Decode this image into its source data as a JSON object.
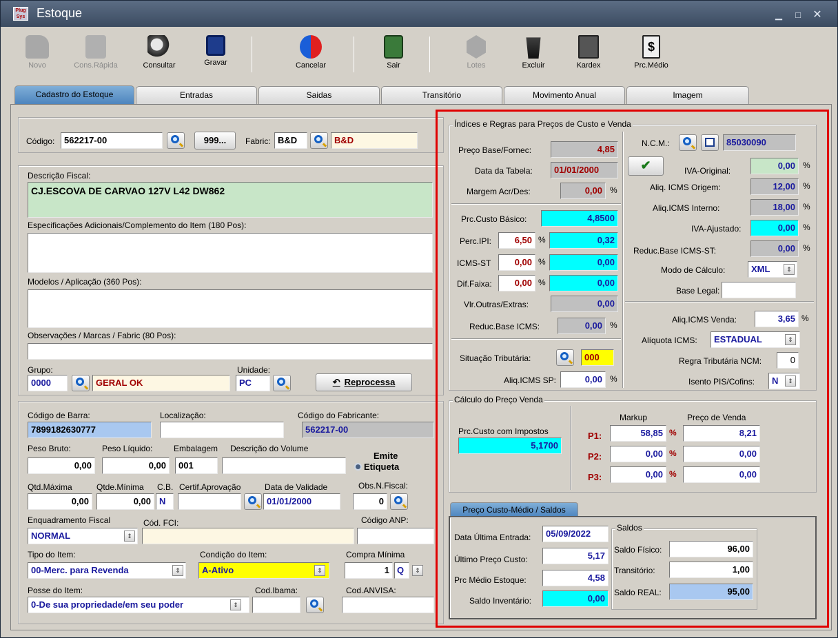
{
  "window": {
    "title": "Estoque",
    "logo": "Plug Sys"
  },
  "toolbar": [
    {
      "label": "Novo",
      "icon": "hand-icon",
      "enabled": false
    },
    {
      "label": "Cons.Rápida",
      "icon": "computer-icon",
      "enabled": false
    },
    {
      "label": "Consultar",
      "icon": "magnifier-icon",
      "enabled": true
    },
    {
      "label": "Gravar",
      "icon": "floppy-icon",
      "enabled": true
    },
    {
      "label": "Cancelar",
      "icon": "refresh-icon",
      "enabled": true
    },
    {
      "label": "Sair",
      "icon": "exit-door-icon",
      "enabled": true
    },
    {
      "label": "Lotes",
      "icon": "hexagon-icon",
      "enabled": false
    },
    {
      "label": "Excluir",
      "icon": "trash-icon",
      "enabled": true
    },
    {
      "label": "Kardex",
      "icon": "folder-icon",
      "enabled": true
    },
    {
      "label": "Prc.Médio",
      "icon": "dollar-doc-icon",
      "enabled": true
    }
  ],
  "tabs": [
    "Cadastro do Estoque",
    "Entradas",
    "Saidas",
    "Transitório",
    "Movimento Anual",
    "Imagem"
  ],
  "left": {
    "codigo_label": "Código:",
    "codigo": "562217-00",
    "btn999": "999...",
    "fabric_label": "Fabric:",
    "fabric_code": "B&D",
    "fabric_name": "B&D",
    "descricao_label": "Descrição Fiscal:",
    "descricao": "CJ.ESCOVA DE CARVAO 127V L42 DW862",
    "especificacoes_label": "Especificações Adicionais/Complemento do Item (180 Pos):",
    "modelos_label": "Modelos / Aplicação (360 Pos):",
    "observacoes_label": "Observações / Marcas / Fabric (80 Pos):",
    "grupo_label": "Grupo:",
    "grupo_code": "0000",
    "grupo_name": "GERAL OK",
    "unidade_label": "Unidade:",
    "unidade": "PC",
    "reprocessa": "Reprocessa",
    "codbarra_label": "Código de Barra:",
    "codbarra": "7899182630777",
    "localizacao_label": "Localização:",
    "codfab_label": "Código do Fabricante:",
    "codfab": "562217-00",
    "pesobruto_label": "Peso Bruto:",
    "pesobruto": "0,00",
    "pesoliq_label": "Peso Líquido:",
    "pesoliq": "0,00",
    "embalagem_label": "Embalagem",
    "embalagem": "001",
    "descvol_label": "Descrição do Volume",
    "emite_label": "Emite",
    "etiqueta_label": "Etiqueta",
    "qtdmax_label": "Qtd.Máxima",
    "qtdmax": "0,00",
    "qtdmin_label": "Qtde.Mínima",
    "qtdmin": "0,00",
    "cb_label": "C.B.",
    "cb": "N",
    "certif_label": "Certif.Aprovação",
    "validade_label": "Data de Validade",
    "validade": "01/01/2000",
    "obsnf_label": "Obs.N.Fiscal:",
    "obsnf": "0",
    "enquad_label": "Enquadramento Fiscal",
    "enquad": "NORMAL",
    "codfci_label": "Cód. FCI:",
    "anp_label": "Código ANP:",
    "tipo_label": "Tipo do Item:",
    "tipo": "00-Merc. para Revenda",
    "condicao_label": "Condição do Item:",
    "condicao": "A-Ativo",
    "compramin_label": "Compra Mínima",
    "compramin": "1",
    "compramin_unit": "Q",
    "posse_label": "Posse do Item:",
    "posse": "0-De sua propriedade/em seu poder",
    "ibama_label": "Cod.Ibama:",
    "anvisa_label": "Cod.ANVISA:"
  },
  "indices": {
    "legend": "Índices e Regras para Preços de Custo e Venda",
    "precobase_label": "Preço Base/Fornec:",
    "precobase": "4,85",
    "datatabela_label": "Data da Tabela:",
    "datatabela": "01/01/2000",
    "margem_label": "Margem Acr/Des:",
    "margem": "0,00",
    "custobasico_label": "Prc.Custo Básico:",
    "custobasico": "4,8500",
    "percipi_label": "Perc.IPI:",
    "percipi": "6,50",
    "percipi_val": "0,32",
    "icmsst_label": "ICMS-ST",
    "icmsst": "0,00",
    "icmsst_val": "0,00",
    "diffaixa_label": "Dif.Faixa:",
    "diffaixa": "0,00",
    "diffaixa_val": "0,00",
    "outras_label": "Vlr.Outras/Extras:",
    "outras": "0,00",
    "reducbase_label": "Reduc.Base ICMS:",
    "reducbase": "0,00",
    "situacao_label": "Situação Tributária:",
    "situacao": "000",
    "aliqsp_label": "Aliq.ICMS SP:",
    "aliqsp": "0,00",
    "ncm_label": "N.C.M.:",
    "ncm": "85030090",
    "ivaorig_label": "IVA-Original:",
    "ivaorig": "0,00",
    "aliqorig_label": "Aliq. ICMS Origem:",
    "aliqorig": "12,00",
    "aliqint_label": "Aliq.ICMS Interno:",
    "aliqint": "18,00",
    "ivaaj_label": "IVA-Ajustado:",
    "ivaaj": "0,00",
    "reducst_label": "Reduc.Base ICMS-ST:",
    "reducst": "0,00",
    "modo_label": "Modo de Cálculo:",
    "modo": "XML",
    "baselegal_label": "Base Legal:",
    "aliqvenda_label": "Aliq.ICMS Venda:",
    "aliqvenda": "3,65",
    "aliquota_label": "Alíquota ICMS:",
    "aliquota": "ESTADUAL",
    "regra_label": "Regra Tributária NCM:",
    "regra": "0",
    "isento_label": "Isento PIS/Cofins:",
    "isento": "N",
    "pct": "%"
  },
  "calculo": {
    "legend": "Cálculo do Preço Venda",
    "custoimp_label": "Prc.Custo com Impostos",
    "custoimp": "5,1700",
    "markup_label": "Markup",
    "pvenda_label": "Preço de Venda",
    "rows": [
      {
        "p": "P1:",
        "markup": "58,85",
        "venda": "8,21"
      },
      {
        "p": "P2:",
        "markup": "0,00",
        "venda": "0,00"
      },
      {
        "p": "P3:",
        "markup": "0,00",
        "venda": "0,00"
      }
    ]
  },
  "saldos": {
    "tab": "Preço Custo-Médio / Saldos",
    "ultentrada_label": "Data Última Entrada:",
    "ultentrada": "05/09/2022",
    "ultpreco_label": "Último Preço Custo:",
    "ultpreco": "5,17",
    "medio_label": "Prc Médio Estoque:",
    "medio": "4,58",
    "inventario_label": "Saldo Inventário:",
    "inventario": "0,00",
    "saldos_legend": "Saldos",
    "fisico_label": "Saldo Físico:",
    "fisico": "96,00",
    "transitorio_label": "Transitório:",
    "transitorio": "1,00",
    "real_label": "Saldo REAL:",
    "real": "95,00"
  }
}
